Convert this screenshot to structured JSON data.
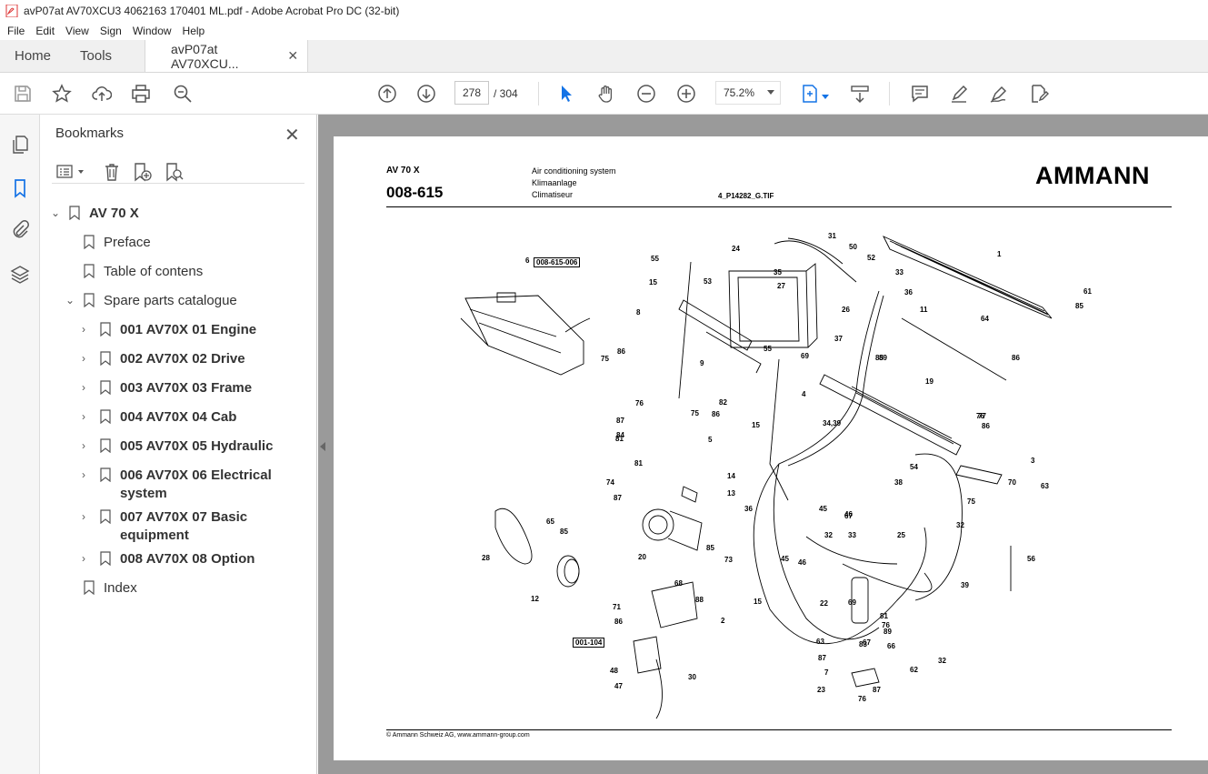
{
  "window": {
    "title": "avP07at AV70XCU3 4062163 170401 ML.pdf - Adobe Acrobat Pro DC (32-bit)"
  },
  "menu": [
    "File",
    "Edit",
    "View",
    "Sign",
    "Window",
    "Help"
  ],
  "tabs": {
    "home": "Home",
    "tools": "Tools",
    "document": "avP07at AV70XCU..."
  },
  "toolbar": {
    "page_current": "278",
    "page_total": "/ 304",
    "zoom": "75.2%"
  },
  "bookmarks": {
    "title": "Bookmarks",
    "items": [
      {
        "label": "AV 70 X",
        "bold": true
      },
      {
        "label": "Preface"
      },
      {
        "label": "Table of contens"
      },
      {
        "label": "Spare parts catalogue"
      },
      {
        "label": "001 AV70X 01 Engine",
        "bold": true
      },
      {
        "label": "002 AV70X 02 Drive",
        "bold": true
      },
      {
        "label": "003 AV70X 03 Frame",
        "bold": true
      },
      {
        "label": "004 AV70X 04 Cab",
        "bold": true
      },
      {
        "label": "005 AV70X 05 Hydraulic",
        "bold": true
      },
      {
        "label": "006 AV70X 06 Electrical system",
        "bold": true
      },
      {
        "label": "007 AV70X 07 Basic equipment",
        "bold": true
      },
      {
        "label": "008 AV70X 08 Option",
        "bold": true
      },
      {
        "label": "Index"
      }
    ]
  },
  "document": {
    "model": "AV 70 X",
    "code": "008-615",
    "title_en": "Air conditioning system",
    "title_de": "Klimaanlage",
    "title_fr": "Climatiseur",
    "file_ref": "4_P14282_G.TIF",
    "logo": "AMMANN",
    "footer": "© Ammann Schweiz AG, www.ammann-group.com",
    "ref_box_1": "008-615-006",
    "ref_box_2": "001-104",
    "part_labels": [
      "1",
      "2",
      "3",
      "4",
      "5",
      "6",
      "7",
      "8",
      "9",
      "11",
      "12",
      "13",
      "14",
      "15",
      "15",
      "15",
      "19",
      "20",
      "22",
      "23",
      "24",
      "25",
      "26",
      "27",
      "28",
      "30",
      "31",
      "32",
      "32",
      "32",
      "33",
      "33",
      "34,39",
      "35",
      "36",
      "36",
      "37",
      "38",
      "39",
      "45",
      "45",
      "46",
      "46",
      "47",
      "48",
      "50",
      "52",
      "53",
      "54",
      "55",
      "55",
      "56",
      "61",
      "62",
      "63",
      "63",
      "64",
      "65",
      "66",
      "67",
      "67",
      "68",
      "69",
      "69",
      "70",
      "71",
      "73",
      "74",
      "75",
      "75",
      "75",
      "76",
      "76",
      "76",
      "76",
      "77",
      "81",
      "81",
      "81",
      "82",
      "83",
      "84",
      "85",
      "85",
      "85",
      "85",
      "86",
      "86",
      "86",
      "86",
      "86",
      "87",
      "87",
      "87",
      "87",
      "88",
      "89",
      "89"
    ]
  }
}
